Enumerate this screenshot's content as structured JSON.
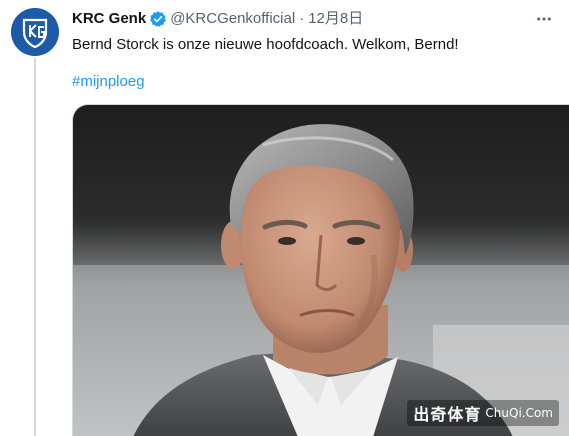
{
  "tweet": {
    "account": {
      "display_name": "KRC Genk",
      "handle": "@KRCGenkofficial",
      "verified": true,
      "avatar_icon": "krc-genk-crest-logo",
      "avatar_color": "#1d5aa8"
    },
    "separator": "·",
    "timestamp": "12月8日",
    "text": "Bernd Storck is onze nieuwe hoofdcoach. Welkom, Bernd!",
    "hashtag": "#mijnploeg",
    "media": {
      "type": "photo",
      "subject": "portrait"
    },
    "watermark": {
      "chinese": "出奇体育",
      "latin": "ChuQi.Com"
    }
  },
  "colors": {
    "text_primary": "#0f1419",
    "text_secondary": "#536471",
    "link": "#1d9bf0",
    "verified_badge": "#1d9bf0",
    "thread_line": "#cfd9de"
  }
}
